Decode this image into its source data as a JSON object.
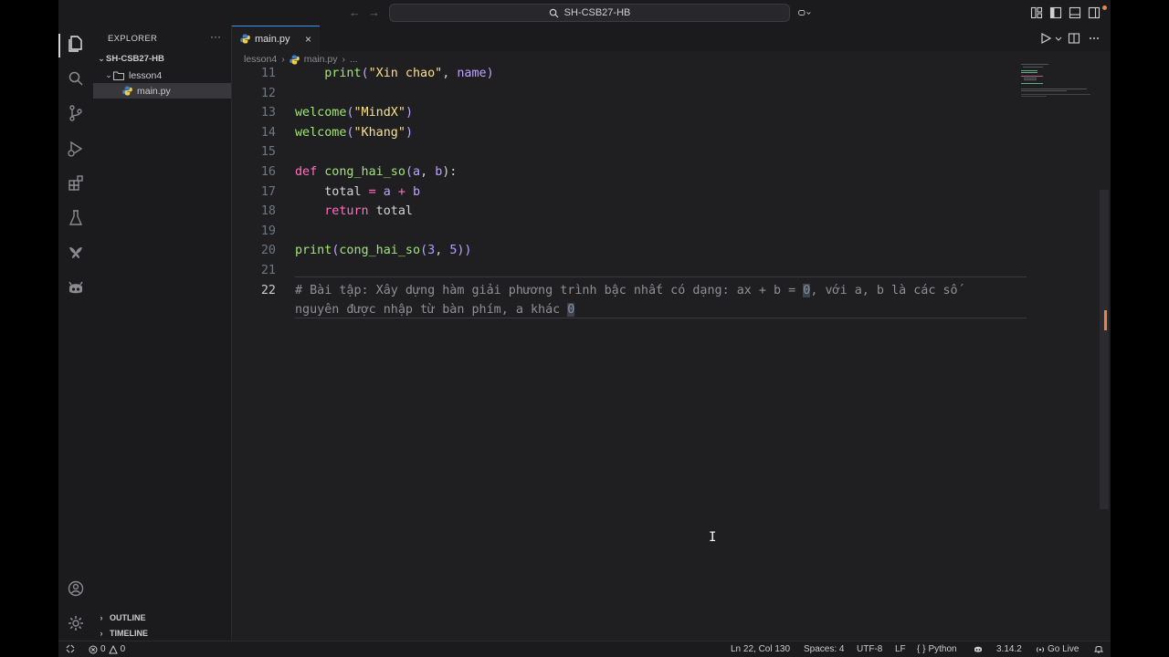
{
  "window": {
    "search_title": "SH-CSB27-HB"
  },
  "sidebar": {
    "title": "EXPLORER",
    "more": "···",
    "root": "SH-CSB27-HB",
    "folder": "lesson4",
    "file": "main.py",
    "outline": "OUTLINE",
    "timeline": "TIMELINE"
  },
  "editor": {
    "tab_label": "main.py",
    "tab_close": "×",
    "breadcrumb": {
      "folder": "lesson4",
      "file": "main.py",
      "tail": "..."
    },
    "lines": [
      {
        "n": "11",
        "tokens": [
          [
            "var",
            "    "
          ],
          [
            "fn",
            "print"
          ],
          [
            "par",
            "("
          ],
          [
            "str",
            "\"Xin chao\""
          ],
          [
            "var",
            ", "
          ],
          [
            "par",
            "name"
          ],
          [
            "par",
            ")"
          ]
        ]
      },
      {
        "n": "12",
        "tokens": []
      },
      {
        "n": "13",
        "tokens": [
          [
            "fn",
            "welcome"
          ],
          [
            "par",
            "("
          ],
          [
            "str",
            "\"MindX\""
          ],
          [
            "par",
            ")"
          ]
        ]
      },
      {
        "n": "14",
        "tokens": [
          [
            "fn",
            "welcome"
          ],
          [
            "par",
            "("
          ],
          [
            "str",
            "\"Khang\""
          ],
          [
            "par",
            ")"
          ]
        ]
      },
      {
        "n": "15",
        "tokens": []
      },
      {
        "n": "16",
        "tokens": [
          [
            "kw",
            "def "
          ],
          [
            "fn",
            "cong_hai_so"
          ],
          [
            "par",
            "("
          ],
          [
            "par",
            "a"
          ],
          [
            "var",
            ", "
          ],
          [
            "par",
            "b"
          ],
          [
            "var",
            "):"
          ]
        ]
      },
      {
        "n": "17",
        "tokens": [
          [
            "var",
            "    total "
          ],
          [
            "kw",
            "="
          ],
          [
            "par",
            " a "
          ],
          [
            "kw",
            "+"
          ],
          [
            "par",
            " b"
          ]
        ]
      },
      {
        "n": "18",
        "tokens": [
          [
            "var",
            "    "
          ],
          [
            "kw",
            "return"
          ],
          [
            "var",
            " total"
          ]
        ]
      },
      {
        "n": "19",
        "tokens": []
      },
      {
        "n": "20",
        "tokens": [
          [
            "fn",
            "print"
          ],
          [
            "par",
            "("
          ],
          [
            "fn",
            "cong_hai_so"
          ],
          [
            "par",
            "("
          ],
          [
            "num",
            "3"
          ],
          [
            "var",
            ", "
          ],
          [
            "num",
            "5"
          ],
          [
            "par",
            "))"
          ]
        ]
      },
      {
        "n": "21",
        "tokens": []
      },
      {
        "n": "22",
        "tokens": [
          [
            "cm",
            "# Bài tập: Xây dựng hàm giải phương trình bậc nhất có dạng: ax + b = "
          ],
          [
            "cmhl",
            "0"
          ],
          [
            "cm",
            ", với a, b là các số"
          ]
        ]
      },
      {
        "n": "",
        "tokens": [
          [
            "cm",
            "nguyên được nhập từ bàn phím, a khác "
          ],
          [
            "cmhl",
            "0"
          ]
        ]
      }
    ]
  },
  "statusbar": {
    "errors": "0",
    "warnings": "0",
    "position": "Ln 22, Col 130",
    "spaces": "Spaces: 4",
    "encoding": "UTF-8",
    "eol": "LF",
    "language": "Python",
    "version": "3.14.2",
    "golive": "Go Live"
  },
  "colors": {
    "accent": "#3794ff",
    "keyword": "#ff6fbe",
    "function": "#9fe870",
    "string": "#fbe08a",
    "number": "#b39dff",
    "comment": "#8f8f95"
  },
  "icons": [
    "explorer-icon",
    "search-icon",
    "source-control-icon",
    "run-debug-icon",
    "extensions-icon",
    "testing-icon",
    "flutter-icon",
    "copilot-icon",
    "account-icon",
    "settings-icon"
  ]
}
